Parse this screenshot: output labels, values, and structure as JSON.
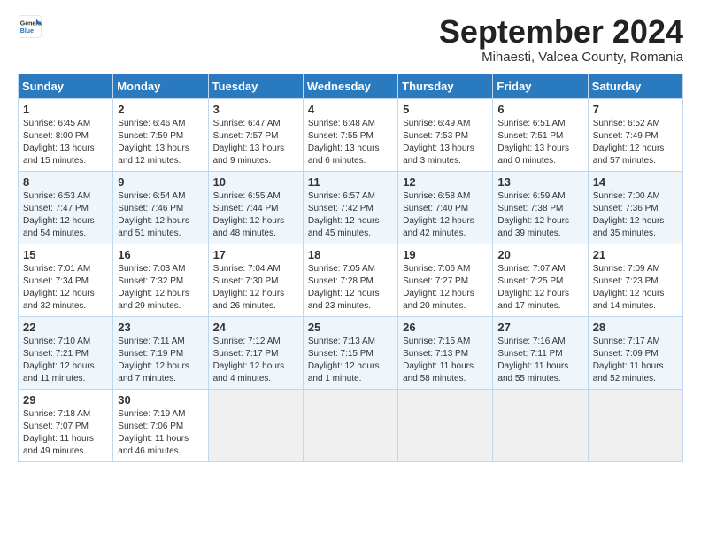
{
  "header": {
    "logo_general": "General",
    "logo_blue": "Blue",
    "month_title": "September 2024",
    "subtitle": "Mihaesti, Valcea County, Romania"
  },
  "weekdays": [
    "Sunday",
    "Monday",
    "Tuesday",
    "Wednesday",
    "Thursday",
    "Friday",
    "Saturday"
  ],
  "weeks": [
    [
      {
        "day": "1",
        "info": "Sunrise: 6:45 AM\nSunset: 8:00 PM\nDaylight: 13 hours\nand 15 minutes."
      },
      {
        "day": "2",
        "info": "Sunrise: 6:46 AM\nSunset: 7:59 PM\nDaylight: 13 hours\nand 12 minutes."
      },
      {
        "day": "3",
        "info": "Sunrise: 6:47 AM\nSunset: 7:57 PM\nDaylight: 13 hours\nand 9 minutes."
      },
      {
        "day": "4",
        "info": "Sunrise: 6:48 AM\nSunset: 7:55 PM\nDaylight: 13 hours\nand 6 minutes."
      },
      {
        "day": "5",
        "info": "Sunrise: 6:49 AM\nSunset: 7:53 PM\nDaylight: 13 hours\nand 3 minutes."
      },
      {
        "day": "6",
        "info": "Sunrise: 6:51 AM\nSunset: 7:51 PM\nDaylight: 13 hours\nand 0 minutes."
      },
      {
        "day": "7",
        "info": "Sunrise: 6:52 AM\nSunset: 7:49 PM\nDaylight: 12 hours\nand 57 minutes."
      }
    ],
    [
      {
        "day": "8",
        "info": "Sunrise: 6:53 AM\nSunset: 7:47 PM\nDaylight: 12 hours\nand 54 minutes."
      },
      {
        "day": "9",
        "info": "Sunrise: 6:54 AM\nSunset: 7:46 PM\nDaylight: 12 hours\nand 51 minutes."
      },
      {
        "day": "10",
        "info": "Sunrise: 6:55 AM\nSunset: 7:44 PM\nDaylight: 12 hours\nand 48 minutes."
      },
      {
        "day": "11",
        "info": "Sunrise: 6:57 AM\nSunset: 7:42 PM\nDaylight: 12 hours\nand 45 minutes."
      },
      {
        "day": "12",
        "info": "Sunrise: 6:58 AM\nSunset: 7:40 PM\nDaylight: 12 hours\nand 42 minutes."
      },
      {
        "day": "13",
        "info": "Sunrise: 6:59 AM\nSunset: 7:38 PM\nDaylight: 12 hours\nand 39 minutes."
      },
      {
        "day": "14",
        "info": "Sunrise: 7:00 AM\nSunset: 7:36 PM\nDaylight: 12 hours\nand 35 minutes."
      }
    ],
    [
      {
        "day": "15",
        "info": "Sunrise: 7:01 AM\nSunset: 7:34 PM\nDaylight: 12 hours\nand 32 minutes."
      },
      {
        "day": "16",
        "info": "Sunrise: 7:03 AM\nSunset: 7:32 PM\nDaylight: 12 hours\nand 29 minutes."
      },
      {
        "day": "17",
        "info": "Sunrise: 7:04 AM\nSunset: 7:30 PM\nDaylight: 12 hours\nand 26 minutes."
      },
      {
        "day": "18",
        "info": "Sunrise: 7:05 AM\nSunset: 7:28 PM\nDaylight: 12 hours\nand 23 minutes."
      },
      {
        "day": "19",
        "info": "Sunrise: 7:06 AM\nSunset: 7:27 PM\nDaylight: 12 hours\nand 20 minutes."
      },
      {
        "day": "20",
        "info": "Sunrise: 7:07 AM\nSunset: 7:25 PM\nDaylight: 12 hours\nand 17 minutes."
      },
      {
        "day": "21",
        "info": "Sunrise: 7:09 AM\nSunset: 7:23 PM\nDaylight: 12 hours\nand 14 minutes."
      }
    ],
    [
      {
        "day": "22",
        "info": "Sunrise: 7:10 AM\nSunset: 7:21 PM\nDaylight: 12 hours\nand 11 minutes."
      },
      {
        "day": "23",
        "info": "Sunrise: 7:11 AM\nSunset: 7:19 PM\nDaylight: 12 hours\nand 7 minutes."
      },
      {
        "day": "24",
        "info": "Sunrise: 7:12 AM\nSunset: 7:17 PM\nDaylight: 12 hours\nand 4 minutes."
      },
      {
        "day": "25",
        "info": "Sunrise: 7:13 AM\nSunset: 7:15 PM\nDaylight: 12 hours\nand 1 minute."
      },
      {
        "day": "26",
        "info": "Sunrise: 7:15 AM\nSunset: 7:13 PM\nDaylight: 11 hours\nand 58 minutes."
      },
      {
        "day": "27",
        "info": "Sunrise: 7:16 AM\nSunset: 7:11 PM\nDaylight: 11 hours\nand 55 minutes."
      },
      {
        "day": "28",
        "info": "Sunrise: 7:17 AM\nSunset: 7:09 PM\nDaylight: 11 hours\nand 52 minutes."
      }
    ],
    [
      {
        "day": "29",
        "info": "Sunrise: 7:18 AM\nSunset: 7:07 PM\nDaylight: 11 hours\nand 49 minutes."
      },
      {
        "day": "30",
        "info": "Sunrise: 7:19 AM\nSunset: 7:06 PM\nDaylight: 11 hours\nand 46 minutes."
      },
      {
        "day": "",
        "info": ""
      },
      {
        "day": "",
        "info": ""
      },
      {
        "day": "",
        "info": ""
      },
      {
        "day": "",
        "info": ""
      },
      {
        "day": "",
        "info": ""
      }
    ]
  ]
}
